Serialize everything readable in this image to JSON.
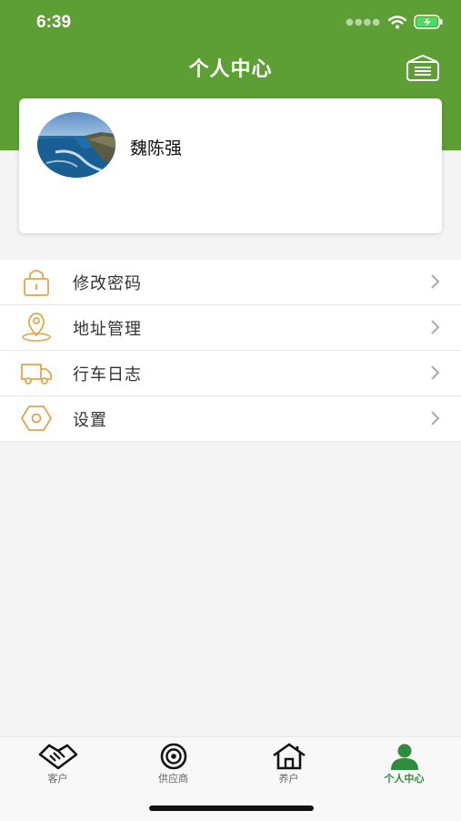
{
  "status_bar": {
    "time": "6:39"
  },
  "header": {
    "title": "个人中心"
  },
  "profile": {
    "name": "魏陈强"
  },
  "menu": [
    {
      "label": "修改密码",
      "icon": "lock-icon"
    },
    {
      "label": "地址管理",
      "icon": "location-pin-icon"
    },
    {
      "label": "行车日志",
      "icon": "truck-icon"
    },
    {
      "label": "设置",
      "icon": "hexagon-settings-icon"
    }
  ],
  "tabs": [
    {
      "label": "客户",
      "icon": "handshake-icon",
      "active": false
    },
    {
      "label": "供应商",
      "icon": "target-icon",
      "active": false
    },
    {
      "label": "养户",
      "icon": "house-icon",
      "active": false
    },
    {
      "label": "个人中心",
      "icon": "person-icon",
      "active": true
    }
  ],
  "colors": {
    "header": "#5e9f35",
    "active_tab": "#2f8c3e",
    "menu_icon": "#e0a64c"
  }
}
